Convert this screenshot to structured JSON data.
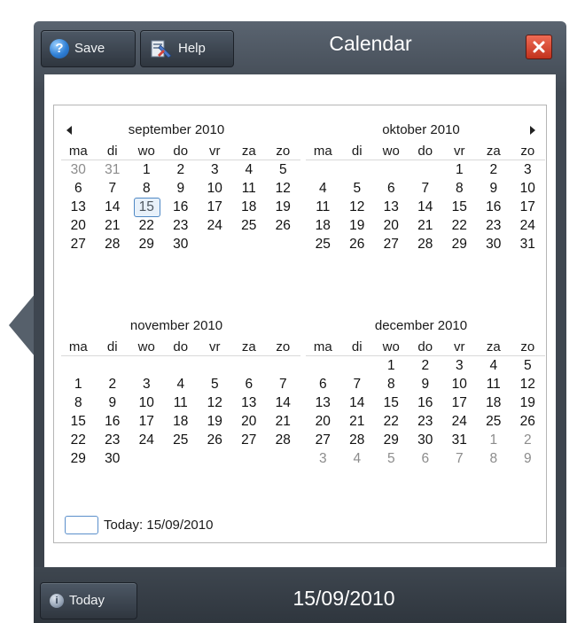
{
  "header": {
    "save_label": "Save",
    "help_label": "Help",
    "title": "Calendar"
  },
  "calendar": {
    "weekdays": [
      "ma",
      "di",
      "wo",
      "do",
      "vr",
      "za",
      "zo"
    ],
    "months": [
      {
        "title": "september 2010",
        "weeks": [
          [
            {
              "d": "30",
              "o": true
            },
            {
              "d": "31",
              "o": true
            },
            {
              "d": "1"
            },
            {
              "d": "2"
            },
            {
              "d": "3"
            },
            {
              "d": "4"
            },
            {
              "d": "5"
            }
          ],
          [
            {
              "d": "6"
            },
            {
              "d": "7"
            },
            {
              "d": "8"
            },
            {
              "d": "9"
            },
            {
              "d": "10"
            },
            {
              "d": "11"
            },
            {
              "d": "12"
            }
          ],
          [
            {
              "d": "13"
            },
            {
              "d": "14"
            },
            {
              "d": "15",
              "sel": true
            },
            {
              "d": "16"
            },
            {
              "d": "17"
            },
            {
              "d": "18"
            },
            {
              "d": "19"
            }
          ],
          [
            {
              "d": "20"
            },
            {
              "d": "21"
            },
            {
              "d": "22"
            },
            {
              "d": "23"
            },
            {
              "d": "24"
            },
            {
              "d": "25"
            },
            {
              "d": "26"
            }
          ],
          [
            {
              "d": "27"
            },
            {
              "d": "28"
            },
            {
              "d": "29"
            },
            {
              "d": "30"
            },
            {
              "d": ""
            },
            {
              "d": ""
            },
            {
              "d": ""
            }
          ]
        ]
      },
      {
        "title": "oktober 2010",
        "weeks": [
          [
            {
              "d": ""
            },
            {
              "d": ""
            },
            {
              "d": ""
            },
            {
              "d": ""
            },
            {
              "d": "1"
            },
            {
              "d": "2"
            },
            {
              "d": "3"
            }
          ],
          [
            {
              "d": "4"
            },
            {
              "d": "5"
            },
            {
              "d": "6"
            },
            {
              "d": "7"
            },
            {
              "d": "8"
            },
            {
              "d": "9"
            },
            {
              "d": "10"
            }
          ],
          [
            {
              "d": "11"
            },
            {
              "d": "12"
            },
            {
              "d": "13"
            },
            {
              "d": "14"
            },
            {
              "d": "15"
            },
            {
              "d": "16"
            },
            {
              "d": "17"
            }
          ],
          [
            {
              "d": "18"
            },
            {
              "d": "19"
            },
            {
              "d": "20"
            },
            {
              "d": "21"
            },
            {
              "d": "22"
            },
            {
              "d": "23"
            },
            {
              "d": "24"
            }
          ],
          [
            {
              "d": "25"
            },
            {
              "d": "26"
            },
            {
              "d": "27"
            },
            {
              "d": "28"
            },
            {
              "d": "29"
            },
            {
              "d": "30"
            },
            {
              "d": "31"
            }
          ]
        ]
      },
      {
        "title": "november 2010",
        "weeks": [
          [
            {
              "d": ""
            },
            {
              "d": ""
            },
            {
              "d": ""
            },
            {
              "d": ""
            },
            {
              "d": ""
            },
            {
              "d": ""
            },
            {
              "d": ""
            }
          ],
          [
            {
              "d": "1"
            },
            {
              "d": "2"
            },
            {
              "d": "3"
            },
            {
              "d": "4"
            },
            {
              "d": "5"
            },
            {
              "d": "6"
            },
            {
              "d": "7"
            }
          ],
          [
            {
              "d": "8"
            },
            {
              "d": "9"
            },
            {
              "d": "10"
            },
            {
              "d": "11"
            },
            {
              "d": "12"
            },
            {
              "d": "13"
            },
            {
              "d": "14"
            }
          ],
          [
            {
              "d": "15"
            },
            {
              "d": "16"
            },
            {
              "d": "17"
            },
            {
              "d": "18"
            },
            {
              "d": "19"
            },
            {
              "d": "20"
            },
            {
              "d": "21"
            }
          ],
          [
            {
              "d": "22"
            },
            {
              "d": "23"
            },
            {
              "d": "24"
            },
            {
              "d": "25"
            },
            {
              "d": "26"
            },
            {
              "d": "27"
            },
            {
              "d": "28"
            }
          ],
          [
            {
              "d": "29"
            },
            {
              "d": "30"
            },
            {
              "d": ""
            },
            {
              "d": ""
            },
            {
              "d": ""
            },
            {
              "d": ""
            },
            {
              "d": ""
            }
          ]
        ]
      },
      {
        "title": "december 2010",
        "weeks": [
          [
            {
              "d": ""
            },
            {
              "d": ""
            },
            {
              "d": "1"
            },
            {
              "d": "2"
            },
            {
              "d": "3"
            },
            {
              "d": "4"
            },
            {
              "d": "5"
            }
          ],
          [
            {
              "d": "6"
            },
            {
              "d": "7"
            },
            {
              "d": "8"
            },
            {
              "d": "9"
            },
            {
              "d": "10"
            },
            {
              "d": "11"
            },
            {
              "d": "12"
            }
          ],
          [
            {
              "d": "13"
            },
            {
              "d": "14"
            },
            {
              "d": "15"
            },
            {
              "d": "16"
            },
            {
              "d": "17"
            },
            {
              "d": "18"
            },
            {
              "d": "19"
            }
          ],
          [
            {
              "d": "20"
            },
            {
              "d": "21"
            },
            {
              "d": "22"
            },
            {
              "d": "23"
            },
            {
              "d": "24"
            },
            {
              "d": "25"
            },
            {
              "d": "26"
            }
          ],
          [
            {
              "d": "27"
            },
            {
              "d": "28"
            },
            {
              "d": "29"
            },
            {
              "d": "30"
            },
            {
              "d": "31"
            },
            {
              "d": "1",
              "o": true
            },
            {
              "d": "2",
              "o": true
            }
          ],
          [
            {
              "d": "3",
              "o": true
            },
            {
              "d": "4",
              "o": true
            },
            {
              "d": "5",
              "o": true
            },
            {
              "d": "6",
              "o": true
            },
            {
              "d": "7",
              "o": true
            },
            {
              "d": "8",
              "o": true
            },
            {
              "d": "9",
              "o": true
            }
          ]
        ]
      }
    ],
    "today_label": "Today: 15/09/2010"
  },
  "footer": {
    "today_button_label": "Today",
    "current_date": "15/09/2010"
  },
  "colors": {
    "frame": "#414953",
    "selected_border": "#4f88c4",
    "close_button": "#d8452e"
  },
  "icons": {
    "save": "question-circle-icon",
    "help": "help-book-icon",
    "close": "close-icon",
    "prev": "triangle-left-icon",
    "next": "triangle-right-icon",
    "today": "info-icon"
  }
}
